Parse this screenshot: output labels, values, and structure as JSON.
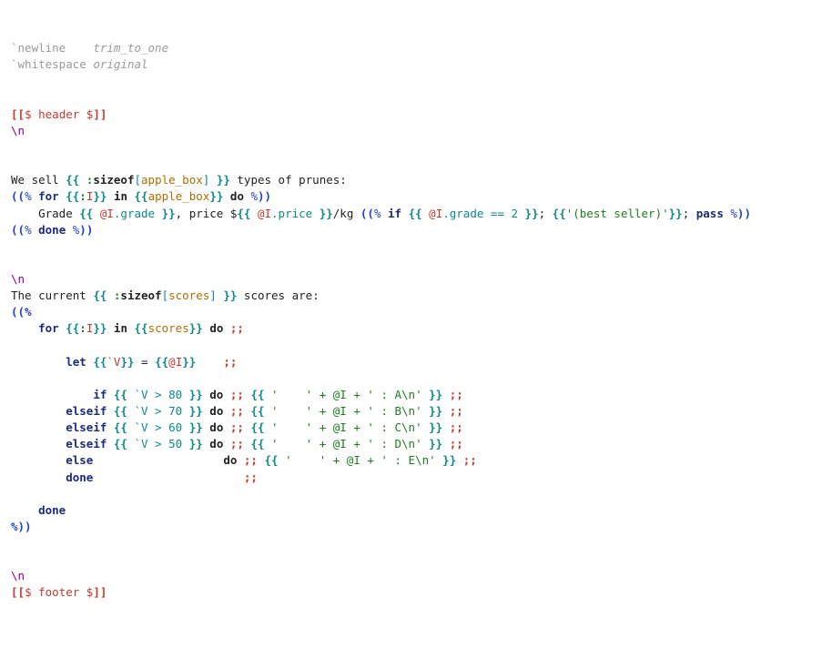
{
  "l1": {
    "a": "`newline    ",
    "b": "trim_to_one"
  },
  "l2": {
    "a": "`whitespace ",
    "b": "original"
  },
  "l3": "",
  "l4": "",
  "l5": {
    "a": "[[",
    "b": "$ header $",
    "c": "]]"
  },
  "l6": "\\n",
  "l7": "",
  "l8": "",
  "l9": {
    "a": "We sell ",
    "b": "{{ ",
    "c": ":",
    "d": "sizeof",
    "e": "[",
    "f": "apple_box",
    "g": "] ",
    "h": "}}",
    " i": " types of prunes:"
  },
  "l10": {
    "a": "((",
    "b": "% ",
    "c": "for ",
    "d": "{{",
    "e": ":",
    "f": "I",
    "g": "}}",
    " h": " in ",
    "i": "{{",
    "j": "apple_box",
    "k": "}}",
    " l": " do ",
    "m": "%",
    "n": "))"
  },
  "l11": {
    "a": "    Grade ",
    "b": "{{ ",
    "c": "@",
    "d": "I",
    "e": ".grade ",
    "f": "}}",
    "g": ", price $",
    "h": "{{ ",
    "i": "@",
    "j": "I",
    "k": ".price ",
    "l": "}}",
    "m": "/kg ",
    "n": "((",
    "o": "% ",
    "p": "if ",
    "q": "{{ ",
    "r": "@",
    "s": "I",
    "t": ".grade == 2 ",
    "u": "}}",
    "v": "; ",
    "w": "{{",
    "x": "'(best seller)'",
    "y": "}}",
    "z": "; ",
    "aa": "pass ",
    "ab": "%",
    "ac": "))"
  },
  "l12": {
    "a": "((",
    "b": "% ",
    "c": "done ",
    "d": "%",
    "e": "))"
  },
  "l13": "",
  "l14": "",
  "l15": "\\n",
  "l16": {
    "a": "The current ",
    "b": "{{ ",
    "c": ":",
    "d": "sizeof",
    "e": "[",
    "f": "scores",
    "g": "] ",
    "h": "}}",
    " i": " scores are:"
  },
  "l17": "((%",
  "l18": {
    "a": "    ",
    "b": "for ",
    "c": "{{",
    "d": ":",
    "e": "I",
    "f": "}}",
    " g": " in ",
    "h": "{{",
    "i": "scores",
    "j": "}}",
    " k": " do ",
    "l": ";;"
  },
  "l19": "",
  "l20": {
    "a": "        ",
    "b": "let ",
    "c": "{{",
    "d": "`V",
    "e": "}}",
    " f": " = ",
    "g": "{{",
    "h": "@",
    "i": "I",
    "j": "}}",
    "k": "    ",
    "l": ";;"
  },
  "l21": "",
  "l22": {
    "a": "            ",
    "b": "if ",
    "c": "{{ ",
    "d": "`V > 80 ",
    "e": "}}",
    "f": " do ",
    "g": ";;",
    "h": " ",
    "i": "{{ ",
    "j": "'    ' + @I + ' : A\\n' ",
    "k": "}}",
    " l": " ",
    "m": ";;"
  },
  "l23": {
    "a": "        ",
    "b": "elseif ",
    "c": "{{ ",
    "d": "`V > 70 ",
    "e": "}}",
    "f": " do ",
    "g": ";;",
    "h": " ",
    "i": "{{ ",
    "j": "'    ' + @I + ' : B\\n' ",
    "k": "}}",
    " l": " ",
    "m": ";;"
  },
  "l24": {
    "a": "        ",
    "b": "elseif ",
    "c": "{{ ",
    "d": "`V > 60 ",
    "e": "}}",
    "f": " do ",
    "g": ";;",
    "h": " ",
    "i": "{{ ",
    "j": "'    ' + @I + ' : C\\n' ",
    "k": "}}",
    " l": " ",
    "m": ";;"
  },
  "l25": {
    "a": "        ",
    "b": "elseif ",
    "c": "{{ ",
    "d": "`V > 50 ",
    "e": "}}",
    "f": " do ",
    "g": ";;",
    "h": " ",
    "i": "{{ ",
    "j": "'    ' + @I + ' : D\\n' ",
    "k": "}}",
    " l": " ",
    "m": ";;"
  },
  "l26": {
    "a": "        ",
    "b": "else",
    "c": "                   do ",
    "d": ";;",
    "e": " ",
    "f": "{{ ",
    "g": "'    ' + @I + ' : E\\n' ",
    "h": "}}",
    " i": " ",
    "j": ";;"
  },
  "l27": {
    "a": "        ",
    "b": "done",
    "c": "                      ",
    "d": ";;"
  },
  "l28": "",
  "l29": {
    "a": "    ",
    "b": "done"
  },
  "l30": "%))",
  "l31": "",
  "l32": "",
  "l33": "\\n",
  "l34": {
    "a": "[[",
    "b": "$ footer $",
    "c": "]]"
  }
}
